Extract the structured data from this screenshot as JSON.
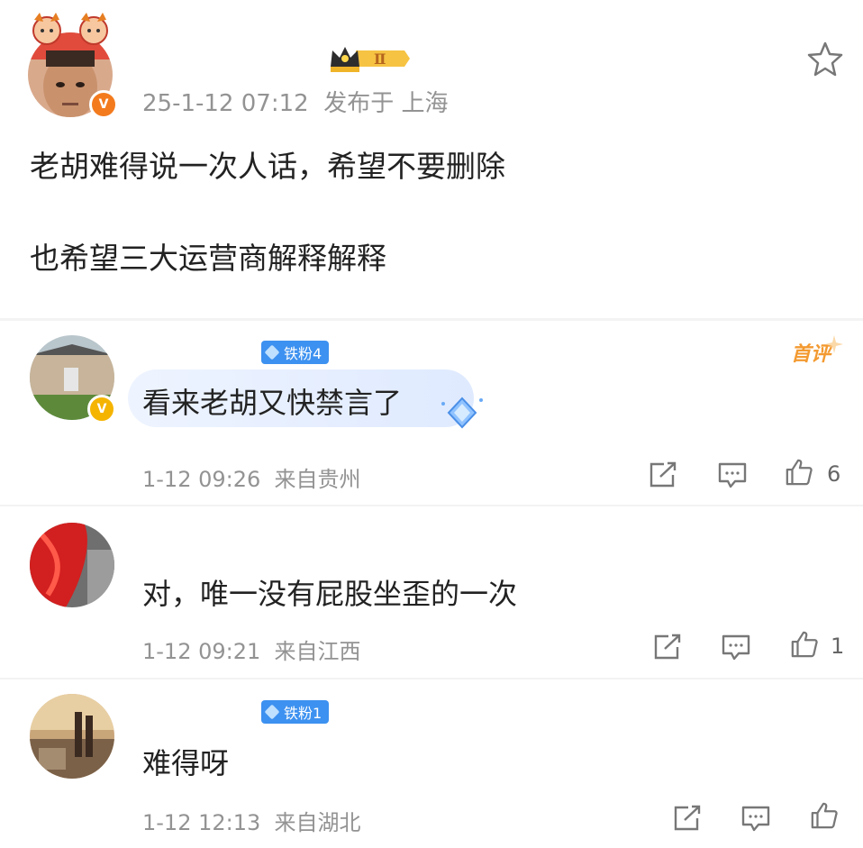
{
  "post": {
    "timestamp": "25-1-12 07:12",
    "location": "发布于 上海",
    "line1": "老胡难得说一次人话，希望不要删除",
    "line2": "也希望三大运营商解释解释"
  },
  "comments": [
    {
      "fan_badge": "铁粉4",
      "text": "看来老胡又快禁言了",
      "time": "1-12 09:26",
      "from": "来自贵州",
      "likes": "6",
      "first_tag": "首评"
    },
    {
      "text": "对，唯一没有屁股坐歪的一次",
      "time": "1-12 09:21",
      "from": "来自江西",
      "likes": "1"
    },
    {
      "fan_badge": "铁粉1",
      "text": "难得呀",
      "time": "1-12 12:13",
      "from": "来自湖北"
    }
  ],
  "colors": {
    "fan_badge": "#3d91f0",
    "first_tag": "#f39a31",
    "meta_text": "#939393",
    "verified_orange": "#f37b1e",
    "verified_gold": "#f5b400"
  },
  "icons": [
    "star-icon",
    "crown-badge-icon",
    "share-icon",
    "comment-icon",
    "like-icon",
    "diamond-icon"
  ]
}
